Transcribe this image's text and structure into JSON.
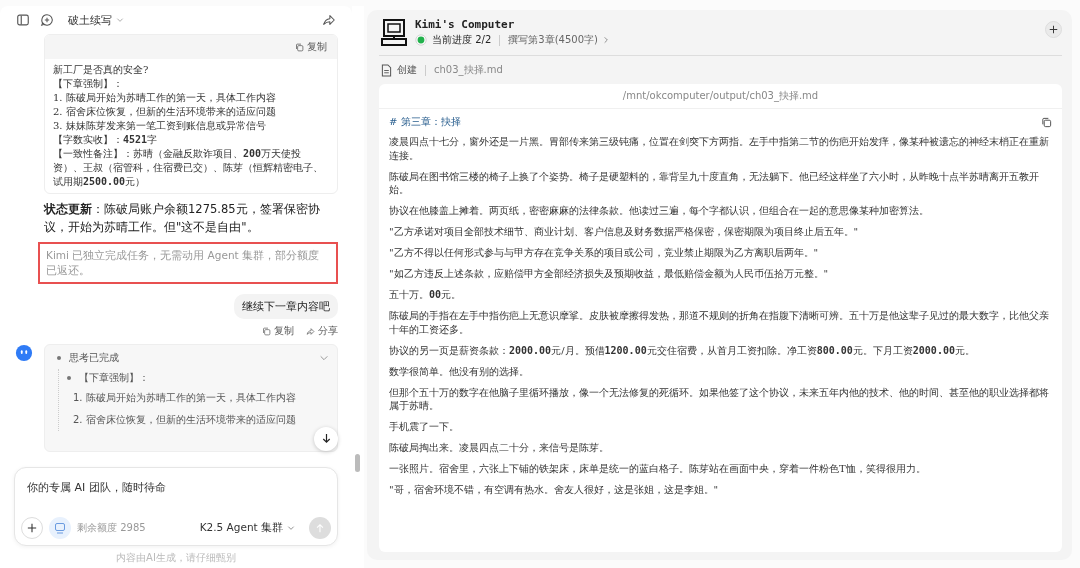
{
  "sidebar_header": {
    "title": "破土续写"
  },
  "code_block": {
    "copy_label": "复制",
    "lines": [
      "新工厂是否真的安全?",
      "【下章强制】：",
      "1. 陈破局开始为苏晴工作的第一天，具体工作内容",
      "2. 宿舍床位恢复，但新的生活环境带来的适应问题",
      "3. 妹妹陈芽发来第一笔工资到账信息或异常信号",
      "【字数实收】：**4521**字",
      "【一致性备注】：苏晴（金融反欺诈项目、**200**万天使投资）、王叔（宿管科，住宿费已交）、陈芽（恒辉精密电子、试用期**2500.00**元）"
    ]
  },
  "status_update": "**状态更新**：陈破局账户余额1275.85元，签署保密协议，开始为苏晴工作。但\"这不是自由\"。",
  "notice": "Kimi 已独立完成任务，无需动用 Agent 集群，部分额度已返还。",
  "user_message": {
    "text": "继续下一章内容吧",
    "actions": [
      "复制",
      "分享"
    ]
  },
  "thinking": {
    "title": "思考已完成",
    "expanded": true,
    "items": [
      {
        "text": "【下章强制】：",
        "children": [
          "1. 陈破局开始为苏晴工作的第一天，具体工作内容",
          "2. 宿舍床位恢复，但新的生活环境带来的适应问题"
        ]
      }
    ]
  },
  "composer": {
    "placeholder": "你的专属 AI 团队，随时待命",
    "quota": "剩余额度 2985",
    "model": "K2.5 Agent 集群",
    "footer": "内容由AI生成，请仔细甄别"
  },
  "computer": {
    "title": "Kimi's Computer",
    "progress": "当前进度 2/2",
    "step": "撰写第3章(4500字)",
    "action": "创建",
    "filename": "ch03_抉择.md",
    "path": "/mnt/okcomputer/output/ch03_抉择.md",
    "heading": "# 第三章：抉择",
    "paragraphs": [
      "凌晨四点十七分，窗外还是一片黑。胃部传来第三级钝痛，位置在剑突下方两指。左手中指第二节的伤疤开始发痒，像某种被遗忘的神经末梢正在重新连接。",
      "陈破局在图书馆三楼的椅子上换了个姿势。椅子是硬塑料的，靠背呈九十度直角，无法躺下。他已经这样坐了六小时，从昨晚十点半苏晴离开五教开始。",
      "协议在他膝盖上摊着。两页纸，密密麻麻的法律条款。他读过三遍，每个字都认识，但组合在一起的意思像某种加密算法。",
      "\"乙方承诺对项目全部技术细节、商业计划、客户信息及财务数据严格保密，保密期限为项目终止后五年。\"",
      "\"乙方不得以任何形式参与与甲方存在竞争关系的项目或公司，竞业禁止期限为乙方离职后两年。\"",
      "\"如乙方违反上述条款，应赔偿甲方全部经济损失及预期收益，最低赔偿金额为人民币伍拾万元整。\"",
      "五十万。**00**元。",
      "陈破局的手指在左手中指伤疤上无意识摩挲。皮肤被摩擦得发热，那道不规则的折角在指腹下清晰可辨。五十万是他这辈子见过的最大数字，比他父亲十年的工资还多。",
      "协议的另一页是薪资条款：**2000.00**元/月。预借**1200.00**元交住宿费，从首月工资扣除。净工资**800.00**元。下月工资**2000.00**元。",
      "数学很简单。他没有别的选择。",
      "但那个五十万的数字在他脑子里循环播放，像一个无法修复的死循环。如果他签了这个协议，未来五年内他的技术、他的时间、甚至他的职业选择都将属于苏晴。",
      "手机震了一下。",
      "陈破局掏出来。凌晨四点二十分，来信号是陈芽。",
      "一张照片。宿舍里，六张上下铺的铁架床，床单是统一的蓝白格子。陈芽站在画面中央，穿着一件粉色T恤，笑得很用力。",
      "\"哥，宿舍环境不错，有空调有热水。舍友人很好，这是张姐，这是李姐。\""
    ]
  }
}
